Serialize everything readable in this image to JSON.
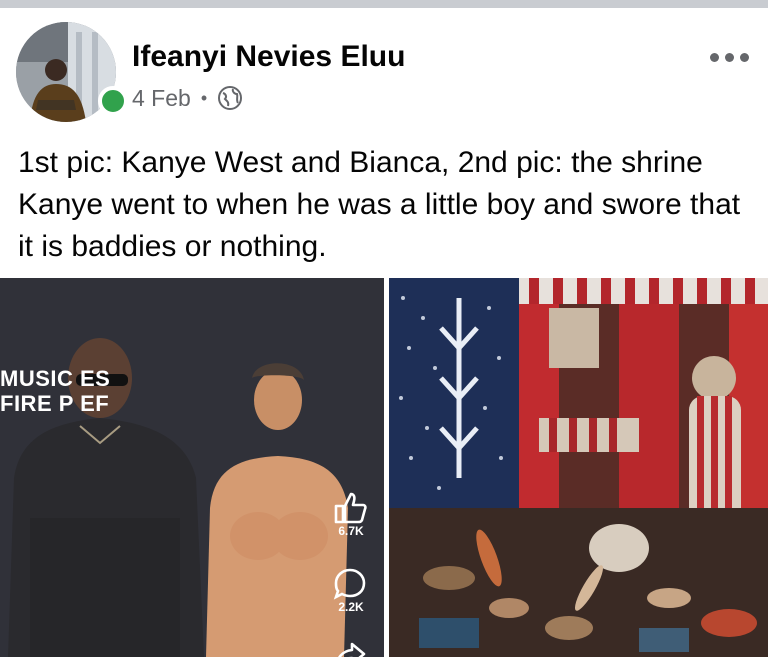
{
  "post": {
    "author": "Ifeanyi Nevies Eluu",
    "date": "4 Feb",
    "separator": "•",
    "audience_icon": "globe-icon",
    "more_icon": "more-options-icon",
    "caption": "1st pic: Kanye West and Bianca, 2nd pic: the shrine Kanye went to when he was a little boy and swore that it is baddies or nothing."
  },
  "photo1": {
    "backdrop_line1": "MUSIC  ES",
    "backdrop_line2": "FIRE P   EF",
    "like_icon": "thumbs-up-icon",
    "like_count": "6.7K",
    "comment_icon": "comment-bubble-icon",
    "comment_count": "2.2K",
    "share_icon": "share-arrow-icon"
  },
  "colors": {
    "online": "#31a24c",
    "meta_text": "#65676b",
    "text": "#050505"
  }
}
